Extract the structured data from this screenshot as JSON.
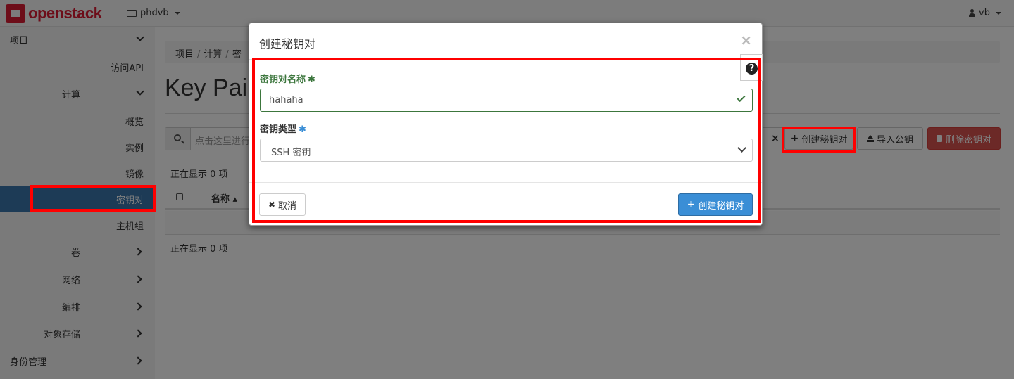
{
  "navbar": {
    "brand": "openstack",
    "project": "phdvb",
    "user": "vb"
  },
  "sidebar": {
    "project": "项目",
    "api_access": "访问API",
    "compute": "计算",
    "overview": "概览",
    "instances": "实例",
    "images": "镜像",
    "key_pairs": "密钥对",
    "server_groups": "主机组",
    "volumes": "卷",
    "network": "网络",
    "orchestration": "编排",
    "object_store": "对象存储",
    "identity": "身份管理"
  },
  "main": {
    "breadcrumb": [
      "项目",
      "计算",
      "密"
    ],
    "title": "Key Pair",
    "search_placeholder": "点击这里进行",
    "create_button": "创建秘钥对",
    "import_button": "导入公钥",
    "delete_button": "删除密钥对",
    "showing_top": "正在显示 0 项",
    "column_name": "名称",
    "showing_bottom": "正在显示 0 项"
  },
  "modal": {
    "title": "创建秘钥对",
    "close": "×",
    "help": "?",
    "name_label": "密钥对名称",
    "name_value": "hahaha",
    "required_mark": "✱",
    "type_label": "密钥类型",
    "type_value": "SSH 密钥",
    "cancel_button": "取消",
    "submit_button": "创建秘钥对"
  },
  "colors": {
    "brand": "#da1a32",
    "active_nav": "#3a76ad",
    "primary": "#3a8ed6",
    "danger": "#d9534f",
    "success": "#3c763d",
    "highlight": "#ff0000"
  }
}
